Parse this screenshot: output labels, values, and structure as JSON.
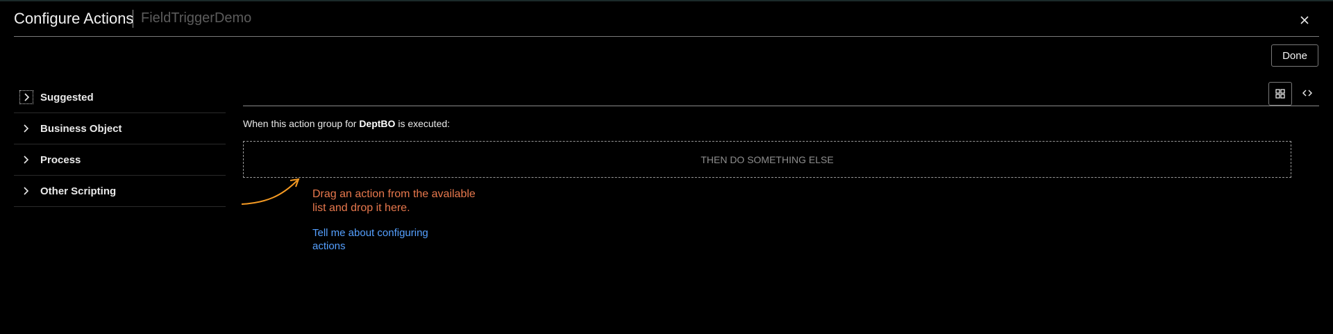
{
  "header": {
    "title": "Configure Actions",
    "subtitle": "FieldTriggerDemo",
    "close_label": "×"
  },
  "toolbar": {
    "done_label": "Done"
  },
  "sidebar": {
    "items": [
      {
        "label": "Suggested",
        "focused": true
      },
      {
        "label": "Business Object"
      },
      {
        "label": "Process"
      },
      {
        "label": "Other Scripting"
      }
    ]
  },
  "view_toggles": [
    {
      "icon": "grid-view-icon",
      "active": true
    },
    {
      "icon": "code-view-icon",
      "active": false
    }
  ],
  "main": {
    "sentence_prefix": "When this action group for",
    "object_name": "DeptBO",
    "sentence_suffix": "is executed:",
    "dropzone_label": "THEN DO SOMETHING ELSE",
    "hint_text": "Drag an action from the available list and drop it here.",
    "help_link": "Tell me about configuring actions"
  },
  "colors": {
    "accent_orange": "#e8784d",
    "arrow_orange": "#f59a23",
    "link_blue": "#55a0ff",
    "background": "#000000"
  }
}
